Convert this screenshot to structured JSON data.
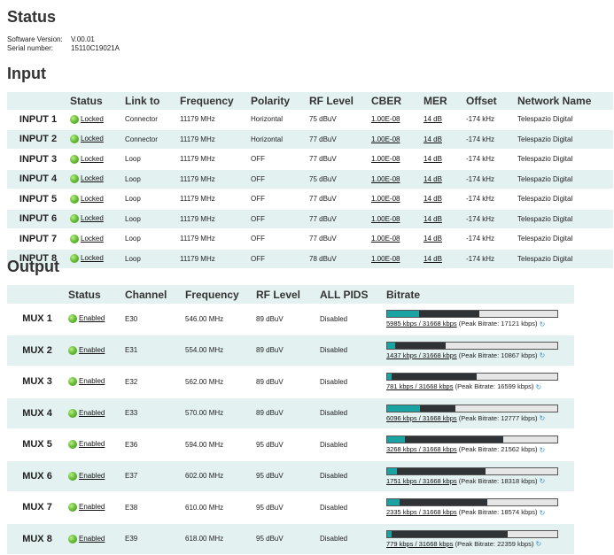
{
  "status": {
    "title": "Status",
    "software_label": "Software Version:",
    "software_value": "V.00.01",
    "serial_label": "Serial number:",
    "serial_value": "15110C19021A"
  },
  "input": {
    "title": "Input",
    "columns": [
      "Status",
      "Link to",
      "Frequency",
      "Polarity",
      "RF Level",
      "CBER",
      "MER",
      "Offset",
      "Network Name"
    ],
    "rows": [
      {
        "name": "INPUT 1",
        "status": "Locked",
        "link": "Connector",
        "freq": "11179 MHz",
        "pol": "Horizontal",
        "rf": "75 dBuV",
        "cber": "1.00E-08",
        "mer": "14 dB",
        "offset": "-174 kHz",
        "network": "Telespazio Digital"
      },
      {
        "name": "INPUT 2",
        "status": "Locked",
        "link": "Connector",
        "freq": "11179 MHz",
        "pol": "Horizontal",
        "rf": "77 dBuV",
        "cber": "1.00E-08",
        "mer": "14 dB",
        "offset": "-174 kHz",
        "network": "Telespazio Digital"
      },
      {
        "name": "INPUT 3",
        "status": "Locked",
        "link": "Loop",
        "freq": "11179 MHz",
        "pol": "OFF",
        "rf": "77 dBuV",
        "cber": "1.00E-08",
        "mer": "14 dB",
        "offset": "-174 kHz",
        "network": "Telespazio Digital"
      },
      {
        "name": "INPUT 4",
        "status": "Locked",
        "link": "Loop",
        "freq": "11179 MHz",
        "pol": "OFF",
        "rf": "75 dBuV",
        "cber": "1.00E-08",
        "mer": "14 dB",
        "offset": "-174 kHz",
        "network": "Telespazio Digital"
      },
      {
        "name": "INPUT 5",
        "status": "Locked",
        "link": "Loop",
        "freq": "11179 MHz",
        "pol": "OFF",
        "rf": "77 dBuV",
        "cber": "1.00E-08",
        "mer": "14 dB",
        "offset": "-174 kHz",
        "network": "Telespazio Digital"
      },
      {
        "name": "INPUT 6",
        "status": "Locked",
        "link": "Loop",
        "freq": "11179 MHz",
        "pol": "OFF",
        "rf": "77 dBuV",
        "cber": "1.00E-08",
        "mer": "14 dB",
        "offset": "-174 kHz",
        "network": "Telespazio Digital"
      },
      {
        "name": "INPUT 7",
        "status": "Locked",
        "link": "Loop",
        "freq": "11179 MHz",
        "pol": "OFF",
        "rf": "77 dBuV",
        "cber": "1.00E-08",
        "mer": "14 dB",
        "offset": "-174 kHz",
        "network": "Telespazio Digital"
      },
      {
        "name": "INPUT 8",
        "status": "Locked",
        "link": "Loop",
        "freq": "11179 MHz",
        "pol": "OFF",
        "rf": "78 dBuV",
        "cber": "1.00E-08",
        "mer": "14 dB",
        "offset": "-174 kHz",
        "network": "Telespazio Digital"
      }
    ]
  },
  "output": {
    "title": "Output",
    "columns": [
      "Status",
      "Channel",
      "Frequency",
      "RF Level",
      "ALL PIDS",
      "Bitrate"
    ],
    "rows": [
      {
        "name": "MUX 1",
        "status": "Enabled",
        "channel": "E30",
        "freq": "546.00 MHz",
        "rf": "89 dBuV",
        "pids": "Disabled",
        "bitrate": "5985 kbps / 31668 kbps",
        "peak": "(Peak Bitrate: 17121 kbps)",
        "cur_kbps": 5985,
        "peak_kbps": 17121,
        "max_kbps": 31668
      },
      {
        "name": "MUX 2",
        "status": "Enabled",
        "channel": "E31",
        "freq": "554.00 MHz",
        "rf": "89 dBuV",
        "pids": "Disabled",
        "bitrate": "1437 kbps / 31668 kbps",
        "peak": "(Peak Bitrate: 10867 kbps)",
        "cur_kbps": 1437,
        "peak_kbps": 10867,
        "max_kbps": 31668
      },
      {
        "name": "MUX 3",
        "status": "Enabled",
        "channel": "E32",
        "freq": "562.00 MHz",
        "rf": "89 dBuV",
        "pids": "Disabled",
        "bitrate": "781 kbps / 31668 kbps",
        "peak": "(Peak Bitrate: 16599 kbps)",
        "cur_kbps": 781,
        "peak_kbps": 16599,
        "max_kbps": 31668
      },
      {
        "name": "MUX 4",
        "status": "Enabled",
        "channel": "E33",
        "freq": "570.00 MHz",
        "rf": "89 dBuV",
        "pids": "Disabled",
        "bitrate": "6096 kbps / 31668 kbps",
        "peak": "(Peak Bitrate: 12777 kbps)",
        "cur_kbps": 6096,
        "peak_kbps": 12777,
        "max_kbps": 31668
      },
      {
        "name": "MUX 5",
        "status": "Enabled",
        "channel": "E36",
        "freq": "594.00 MHz",
        "rf": "95 dBuV",
        "pids": "Disabled",
        "bitrate": "3268 kbps / 31668 kbps",
        "peak": "(Peak Bitrate: 21562 kbps)",
        "cur_kbps": 3268,
        "peak_kbps": 21562,
        "max_kbps": 31668
      },
      {
        "name": "MUX 6",
        "status": "Enabled",
        "channel": "E37",
        "freq": "602.00 MHz",
        "rf": "95 dBuV",
        "pids": "Disabled",
        "bitrate": "1751 kbps / 31668 kbps",
        "peak": "(Peak Bitrate: 18318 kbps)",
        "cur_kbps": 1751,
        "peak_kbps": 18318,
        "max_kbps": 31668
      },
      {
        "name": "MUX 7",
        "status": "Enabled",
        "channel": "E38",
        "freq": "610.00 MHz",
        "rf": "95 dBuV",
        "pids": "Disabled",
        "bitrate": "2335 kbps / 31668 kbps",
        "peak": "(Peak Bitrate: 18574 kbps)",
        "cur_kbps": 2335,
        "peak_kbps": 18574,
        "max_kbps": 31668
      },
      {
        "name": "MUX 8",
        "status": "Enabled",
        "channel": "E39",
        "freq": "618.00 MHz",
        "rf": "95 dBuV",
        "pids": "Disabled",
        "bitrate": "779 kbps / 31668 kbps",
        "peak": "(Peak Bitrate: 22359 kbps)",
        "cur_kbps": 779,
        "peak_kbps": 22359,
        "max_kbps": 31668
      }
    ]
  },
  "colors": {
    "current_bar": "#1aa3a3",
    "peak_bar": "#2f3335",
    "row_alt": "#e4f1f1",
    "status_ok": "#6cc13a"
  },
  "icons": {
    "status": "green-dot-icon",
    "refresh": "refresh-icon"
  }
}
